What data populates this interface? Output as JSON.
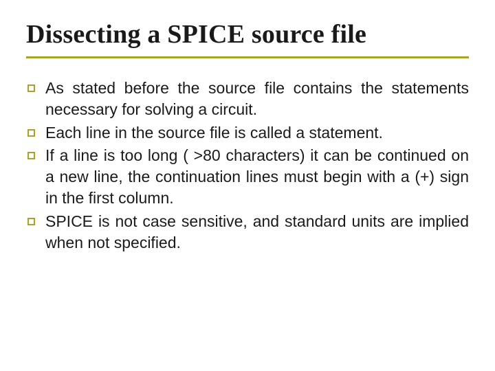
{
  "title": "Dissecting a SPICE source file",
  "bullets": [
    "As stated before the source file contains the statements necessary for solving a circuit.",
    "Each line in the source file is called a statement.",
    "If a line is too long ( >80 characters) it can be continued on a new line, the continuation lines must begin with a (+) sign in the first column.",
    "SPICE is not case sensitive, and standard units are implied when not specified."
  ]
}
